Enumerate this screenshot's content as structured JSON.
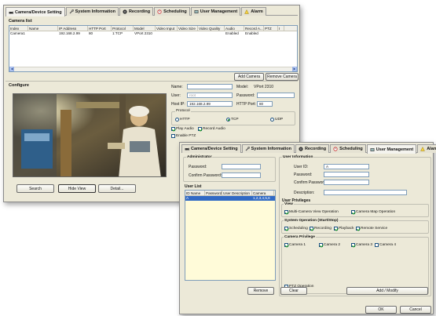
{
  "window1": {
    "tabs": [
      {
        "label": "Camera/Device Setting",
        "icon": "camera-icon",
        "active": true
      },
      {
        "label": "System Information",
        "icon": "wrench-icon",
        "active": false
      },
      {
        "label": "Recording",
        "icon": "film-icon",
        "active": false
      },
      {
        "label": "Scheduling",
        "icon": "clock-icon",
        "active": false
      },
      {
        "label": "User Management",
        "icon": "user-icon",
        "active": false
      },
      {
        "label": "Alarm",
        "icon": "alarm-icon",
        "active": false
      }
    ],
    "camera_list": {
      "title": "Camera list",
      "columns": [
        "Index",
        "Name",
        "IP Address",
        "HTTP Port",
        "Protocol",
        "Model",
        "Video Input",
        "Video Size",
        "Video Quality",
        "Audio",
        "Record A...",
        "PTZ",
        "I"
      ],
      "rows": [
        [
          "Camera1",
          "",
          "192.168.2.99",
          "80",
          "1:TCP",
          "VPort 2310",
          "",
          "",
          "",
          "Enabled",
          "Enabled",
          "",
          ""
        ]
      ]
    },
    "add_camera_label": "Add Camera",
    "remove_camera_label": "Remove Camera",
    "configure": {
      "title": "Configure",
      "name_label": "Name:",
      "name_value": "",
      "model_label": "Model:",
      "model_value": "VPort 2310",
      "user_label": "User:",
      "user_value": "root",
      "password_label": "Password:",
      "password_value": "",
      "host_ip_label": "Host IP:",
      "host_ip_value": "192.168.2.99",
      "http_port_label": "HTTP Port:",
      "http_port_value": "80",
      "protocol_title": "Protocol",
      "protocol_options": [
        "HTTP",
        "TCP",
        "UDP"
      ],
      "protocol_selected": "TCP",
      "play_audio_label": "Play Audio",
      "record_audio_label": "Record Audio",
      "enable_ptz_label": "Enable PTZ",
      "search_label": "Search",
      "hide_view_label": "Hide View",
      "detail_label": "Detail..."
    }
  },
  "window2": {
    "tabs": [
      {
        "label": "Camera/Device Setting",
        "icon": "camera-icon",
        "active": false
      },
      {
        "label": "System Information",
        "icon": "wrench-icon",
        "active": false
      },
      {
        "label": "Recording",
        "icon": "film-icon",
        "active": false
      },
      {
        "label": "Scheduling",
        "icon": "clock-icon",
        "active": false
      },
      {
        "label": "User Management",
        "icon": "user-icon",
        "active": true
      },
      {
        "label": "Alarm",
        "icon": "alarm-icon",
        "active": false
      }
    ],
    "administrator": {
      "title": "Administrator",
      "password_label": "Password:",
      "confirm_password_label": "Confirm Password:"
    },
    "user_list": {
      "title": "User List",
      "columns": [
        "ID Name",
        "Password",
        "User Description",
        "Camera"
      ],
      "rows": [
        [
          "A",
          "",
          "",
          "1,2,3,4,5,6"
        ]
      ]
    },
    "remove_label": "Remove",
    "user_information": {
      "title": "User Information",
      "user_id_label": "User ID:",
      "user_id_value": "A",
      "password_label": "Password:",
      "confirm_password_label": "Confirm Password:",
      "description_label": "Description:"
    },
    "user_privileges_title": "User Privileges",
    "view": {
      "title": "View",
      "options": [
        {
          "label": "Multi-Camera View Operation",
          "checked": true
        },
        {
          "label": "Camera Map Operation",
          "checked": true
        }
      ]
    },
    "system_operation": {
      "title": "System Operation  (Start/Stop)",
      "options": [
        {
          "label": "Scheduling",
          "checked": true
        },
        {
          "label": "Recording",
          "checked": true
        },
        {
          "label": "Playback",
          "checked": true
        },
        {
          "label": "Remote Service",
          "checked": true
        }
      ]
    },
    "camera_privilege": {
      "title": "Camera Privilege",
      "options": [
        {
          "label": "Camera 1",
          "checked": true
        },
        {
          "label": "Camera 2",
          "checked": true
        },
        {
          "label": "Camera 3",
          "checked": true
        },
        {
          "label": "Camera 4",
          "checked": false
        }
      ]
    },
    "ptz_operation_label": "PTZ Operation",
    "clear_label": "Clear",
    "add_modify_label": "Add / Modify",
    "ok_label": "OK",
    "cancel_label": "Cancel"
  }
}
